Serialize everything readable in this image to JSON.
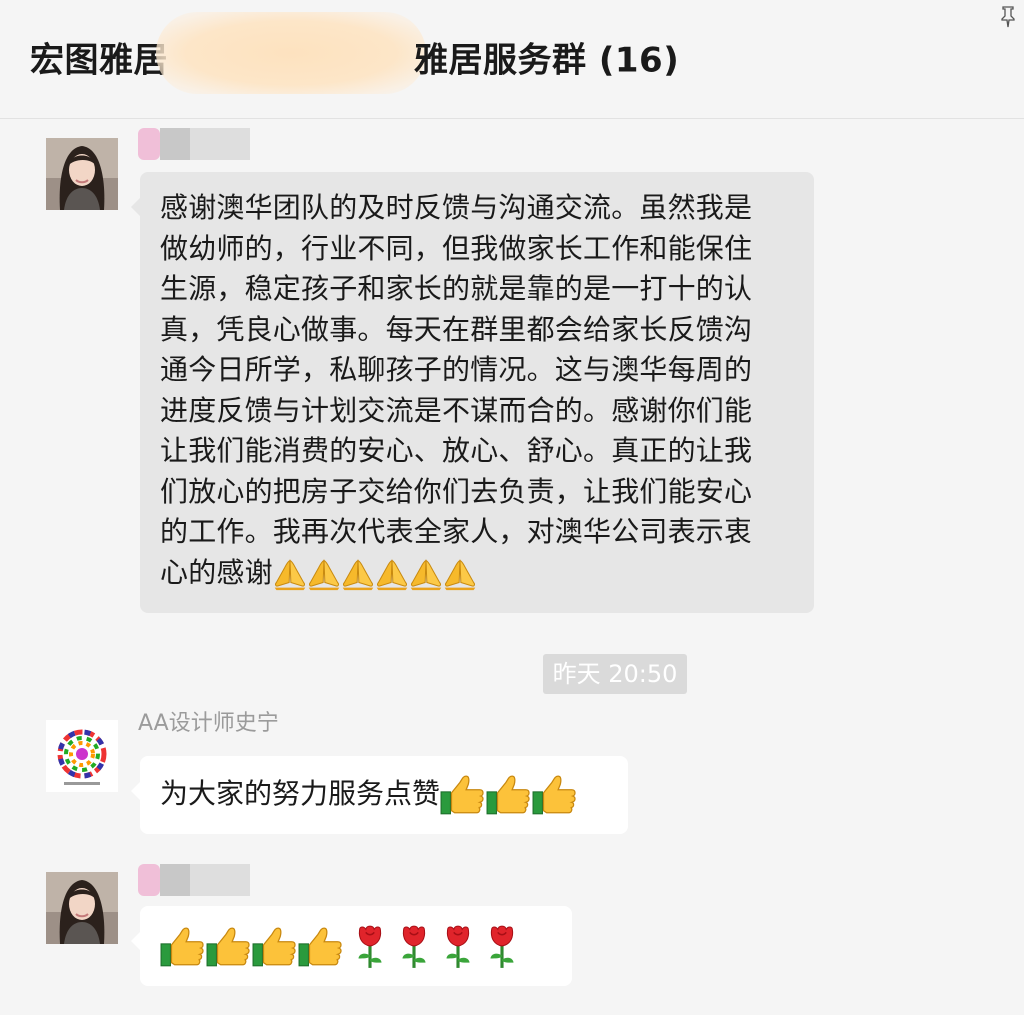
{
  "header": {
    "title_prefix": "宏图雅居",
    "title_suffix": "雅居服务群 (16)",
    "pin_icon": "pin-icon"
  },
  "messages": [
    {
      "sender": "",
      "avatar": "avatar-photo",
      "text": "感谢澳华团队的及时反馈与沟通交流。虽然我是\n做幼师的，行业不同，但我做家长工作和能保住\n生源，稳定孩子和家长的就是靠的是一打十的认\n真，凭良心做事。每天在群里都会给家长反馈沟\n通今日所学，私聊孩子的情况。这与澳华每周的\n进度反馈与计划交流是不谋而合的。感谢你们能\n让我们能消费的安心、放心、舒心。真正的让我\n们放心的把房子交给你们去负责，让我们能安心\n的工作。我再次代表全家人，对澳华公司表示衷\n心的感谢",
      "emojis": [
        "folded-hands-icon",
        "folded-hands-icon",
        "folded-hands-icon",
        "folded-hands-icon",
        "folded-hands-icon",
        "folded-hands-icon"
      ]
    },
    {
      "timestamp": "昨天 20:50"
    },
    {
      "sender": "AA设计师史宁",
      "avatar": "avatar-logo",
      "text": "为大家的努力服务点赞",
      "emojis": [
        "thumbs-up-icon",
        "thumbs-up-icon",
        "thumbs-up-icon"
      ]
    },
    {
      "sender": "",
      "avatar": "avatar-photo",
      "text": "",
      "emojis": [
        "thumbs-up-icon",
        "thumbs-up-icon",
        "thumbs-up-icon",
        "thumbs-up-icon",
        "rose-icon",
        "rose-icon",
        "rose-icon",
        "rose-icon"
      ]
    }
  ],
  "colors": {
    "background": "#f5f5f5",
    "bubble_gray": "#e6e6e6",
    "bubble_white": "#ffffff",
    "timestamp_bg": "#dadada",
    "sender_name": "#9b9b9b"
  }
}
